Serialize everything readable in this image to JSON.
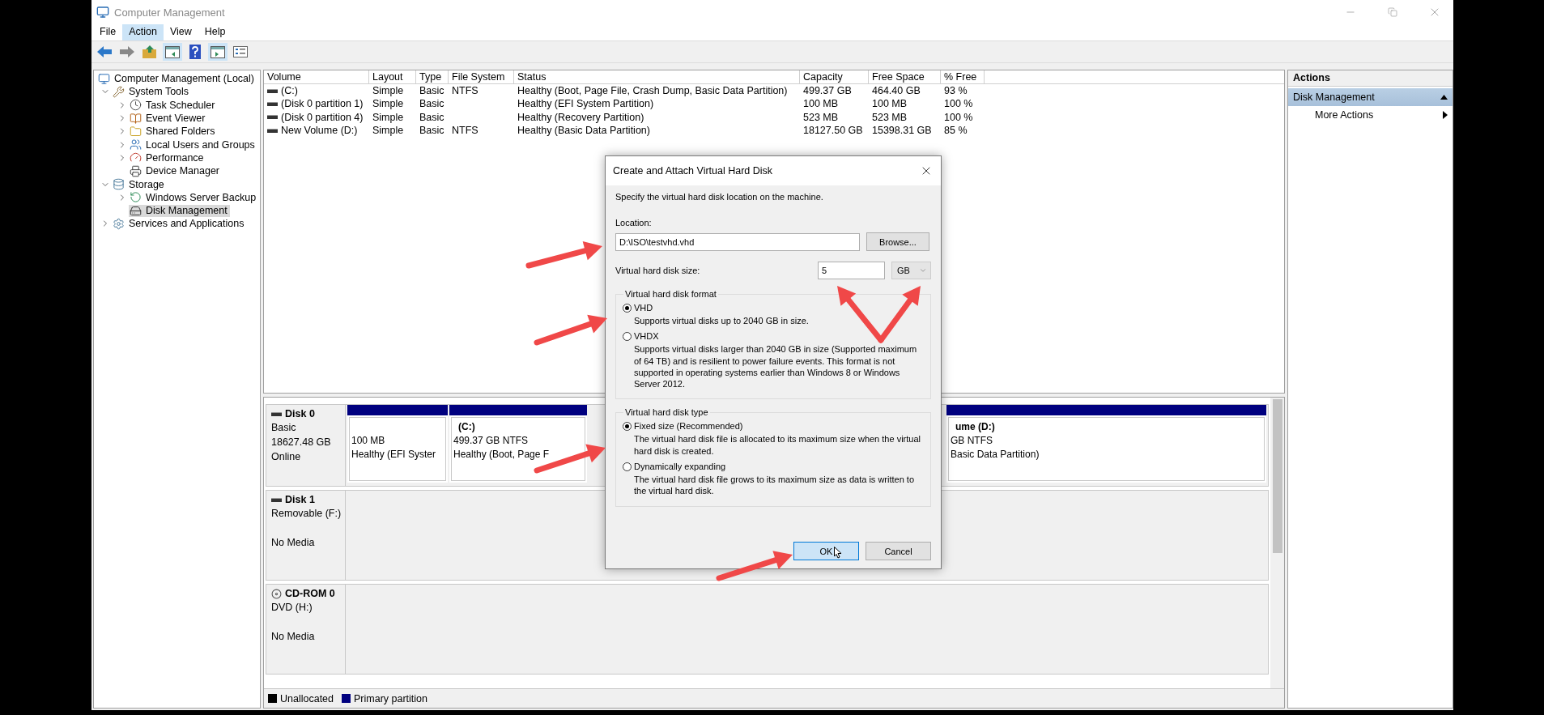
{
  "window": {
    "title": "Computer Management"
  },
  "menu": [
    {
      "label": "File",
      "selected": false
    },
    {
      "label": "Action",
      "selected": true
    },
    {
      "label": "View",
      "selected": false
    },
    {
      "label": "Help",
      "selected": false
    }
  ],
  "toolbar": [
    {
      "kind": "back",
      "pressed": false
    },
    {
      "kind": "forward",
      "pressed": false
    },
    {
      "kind": "up",
      "pressed": false
    },
    {
      "kind": "tree",
      "pressed": true
    },
    {
      "kind": "help",
      "pressed": false
    },
    {
      "kind": "actionpane",
      "pressed": true
    },
    {
      "kind": "properties",
      "pressed": false
    }
  ],
  "tree": [
    {
      "label": "Computer Management (Local)",
      "kind": "computer",
      "selected": false,
      "children": [
        {
          "label": "System Tools",
          "kind": "tools",
          "expanded": true,
          "selected": false,
          "children": [
            {
              "label": "Task Scheduler",
              "kind": "clock",
              "expanded": false,
              "selected": false
            },
            {
              "label": "Event Viewer",
              "kind": "log",
              "expanded": false,
              "selected": false
            },
            {
              "label": "Shared Folders",
              "kind": "folder",
              "expanded": false,
              "selected": false
            },
            {
              "label": "Local Users and Groups",
              "kind": "users",
              "expanded": false,
              "selected": false
            },
            {
              "label": "Performance",
              "kind": "gauge",
              "expanded": false,
              "selected": false
            },
            {
              "label": "Device Manager",
              "kind": "device",
              "selected": false
            }
          ]
        },
        {
          "label": "Storage",
          "kind": "storage",
          "expanded": true,
          "selected": false,
          "children": [
            {
              "label": "Windows Server Backup",
              "kind": "backup",
              "expanded": false,
              "selected": false
            },
            {
              "label": "Disk Management",
              "kind": "disk",
              "selected": true
            }
          ]
        },
        {
          "label": "Services and Applications",
          "kind": "services",
          "expanded": false,
          "selected": false
        }
      ]
    }
  ],
  "volumes": {
    "columns": [
      "Volume",
      "Layout",
      "Type",
      "File System",
      "Status",
      "Capacity",
      "Free Space",
      "% Free"
    ],
    "rows": [
      {
        "volume": "(C:)",
        "layout": "Simple",
        "type": "Basic",
        "file_system": "NTFS",
        "status": "Healthy (Boot, Page File, Crash Dump, Basic Data Partition)",
        "capacity": "499.37 GB",
        "free_space": "464.40 GB",
        "percent_free": "93 %"
      },
      {
        "volume": "(Disk 0 partition 1)",
        "layout": "Simple",
        "type": "Basic",
        "status": "Healthy (EFI System Partition)",
        "capacity": "100 MB",
        "free_space": "100 MB",
        "percent_free": "100 %"
      },
      {
        "volume": "(Disk 0 partition 4)",
        "layout": "Simple",
        "type": "Basic",
        "status": "Healthy (Recovery Partition)",
        "capacity": "523 MB",
        "free_space": "523 MB",
        "percent_free": "100 %"
      },
      {
        "volume": "New Volume (D:)",
        "layout": "Simple",
        "type": "Basic",
        "file_system": "NTFS",
        "status": "Healthy (Basic Data Partition)",
        "capacity": "18127.50 GB",
        "free_space": "15398.31 GB",
        "percent_free": "85 %"
      }
    ]
  },
  "disks": [
    {
      "name": "Disk 0",
      "kind": "disk",
      "type": "Basic",
      "size": "18627.48 GB",
      "status": "Online",
      "partitions": [
        {
          "kind": "partition",
          "lines": [
            "100 MB",
            "Healthy (EFI Syster"
          ]
        },
        {
          "kind": "partition",
          "title": "(C:)",
          "lines": [
            "499.37 GB NTFS",
            "Healthy (Boot, Page F"
          ]
        },
        {
          "kind": "hidden"
        },
        {
          "kind": "partition",
          "title": "ume  (D:)",
          "lines": [
            "GB NTFS",
            "Basic Data Partition)"
          ]
        }
      ]
    },
    {
      "name": "Disk 1",
      "kind": "disk",
      "type": "Removable (F:)",
      "status": "No Media"
    },
    {
      "name": "CD-ROM 0",
      "kind": "cdrom",
      "type": "DVD (H:)",
      "status": "No Media"
    }
  ],
  "legend": [
    {
      "label": "Unallocated",
      "color": "#000000"
    },
    {
      "label": "Primary partition",
      "color": "#00007f"
    }
  ],
  "actions": {
    "title": "Actions",
    "section": "Disk Management",
    "expanded": true,
    "items": [
      "More Actions"
    ]
  },
  "dialog": {
    "title": "Create and Attach Virtual Hard Disk",
    "instruction": "Specify the virtual hard disk location on the machine.",
    "location_label": "Location:",
    "location": "D:\\ISO\\testvhd.vhd",
    "browse": "Browse...",
    "size_label": "Virtual hard disk size:",
    "size": "5",
    "unit": "GB",
    "groups": [
      {
        "title": "Virtual hard disk format",
        "options": [
          {
            "label": "VHD",
            "selected": true,
            "description": "Supports virtual disks up to 2040 GB in size."
          },
          {
            "label": "VHDX",
            "selected": false,
            "description": "Supports virtual disks larger than 2040 GB in size (Supported maximum of 64 TB) and is resilient to power failure events. This format is not supported in operating systems earlier than Windows 8 or Windows Server 2012."
          }
        ]
      },
      {
        "title": "Virtual hard disk type",
        "options": [
          {
            "label": "Fixed size (Recommended)",
            "selected": true,
            "description": "The virtual hard disk file is allocated to its maximum size when the virtual hard disk is created."
          },
          {
            "label": "Dynamically expanding",
            "selected": false,
            "description": "The virtual hard disk file grows to its maximum size as data is written to the virtual hard disk."
          }
        ]
      }
    ],
    "buttons": [
      {
        "label": "OK",
        "focused": true
      },
      {
        "label": "Cancel",
        "focused": false
      }
    ]
  }
}
